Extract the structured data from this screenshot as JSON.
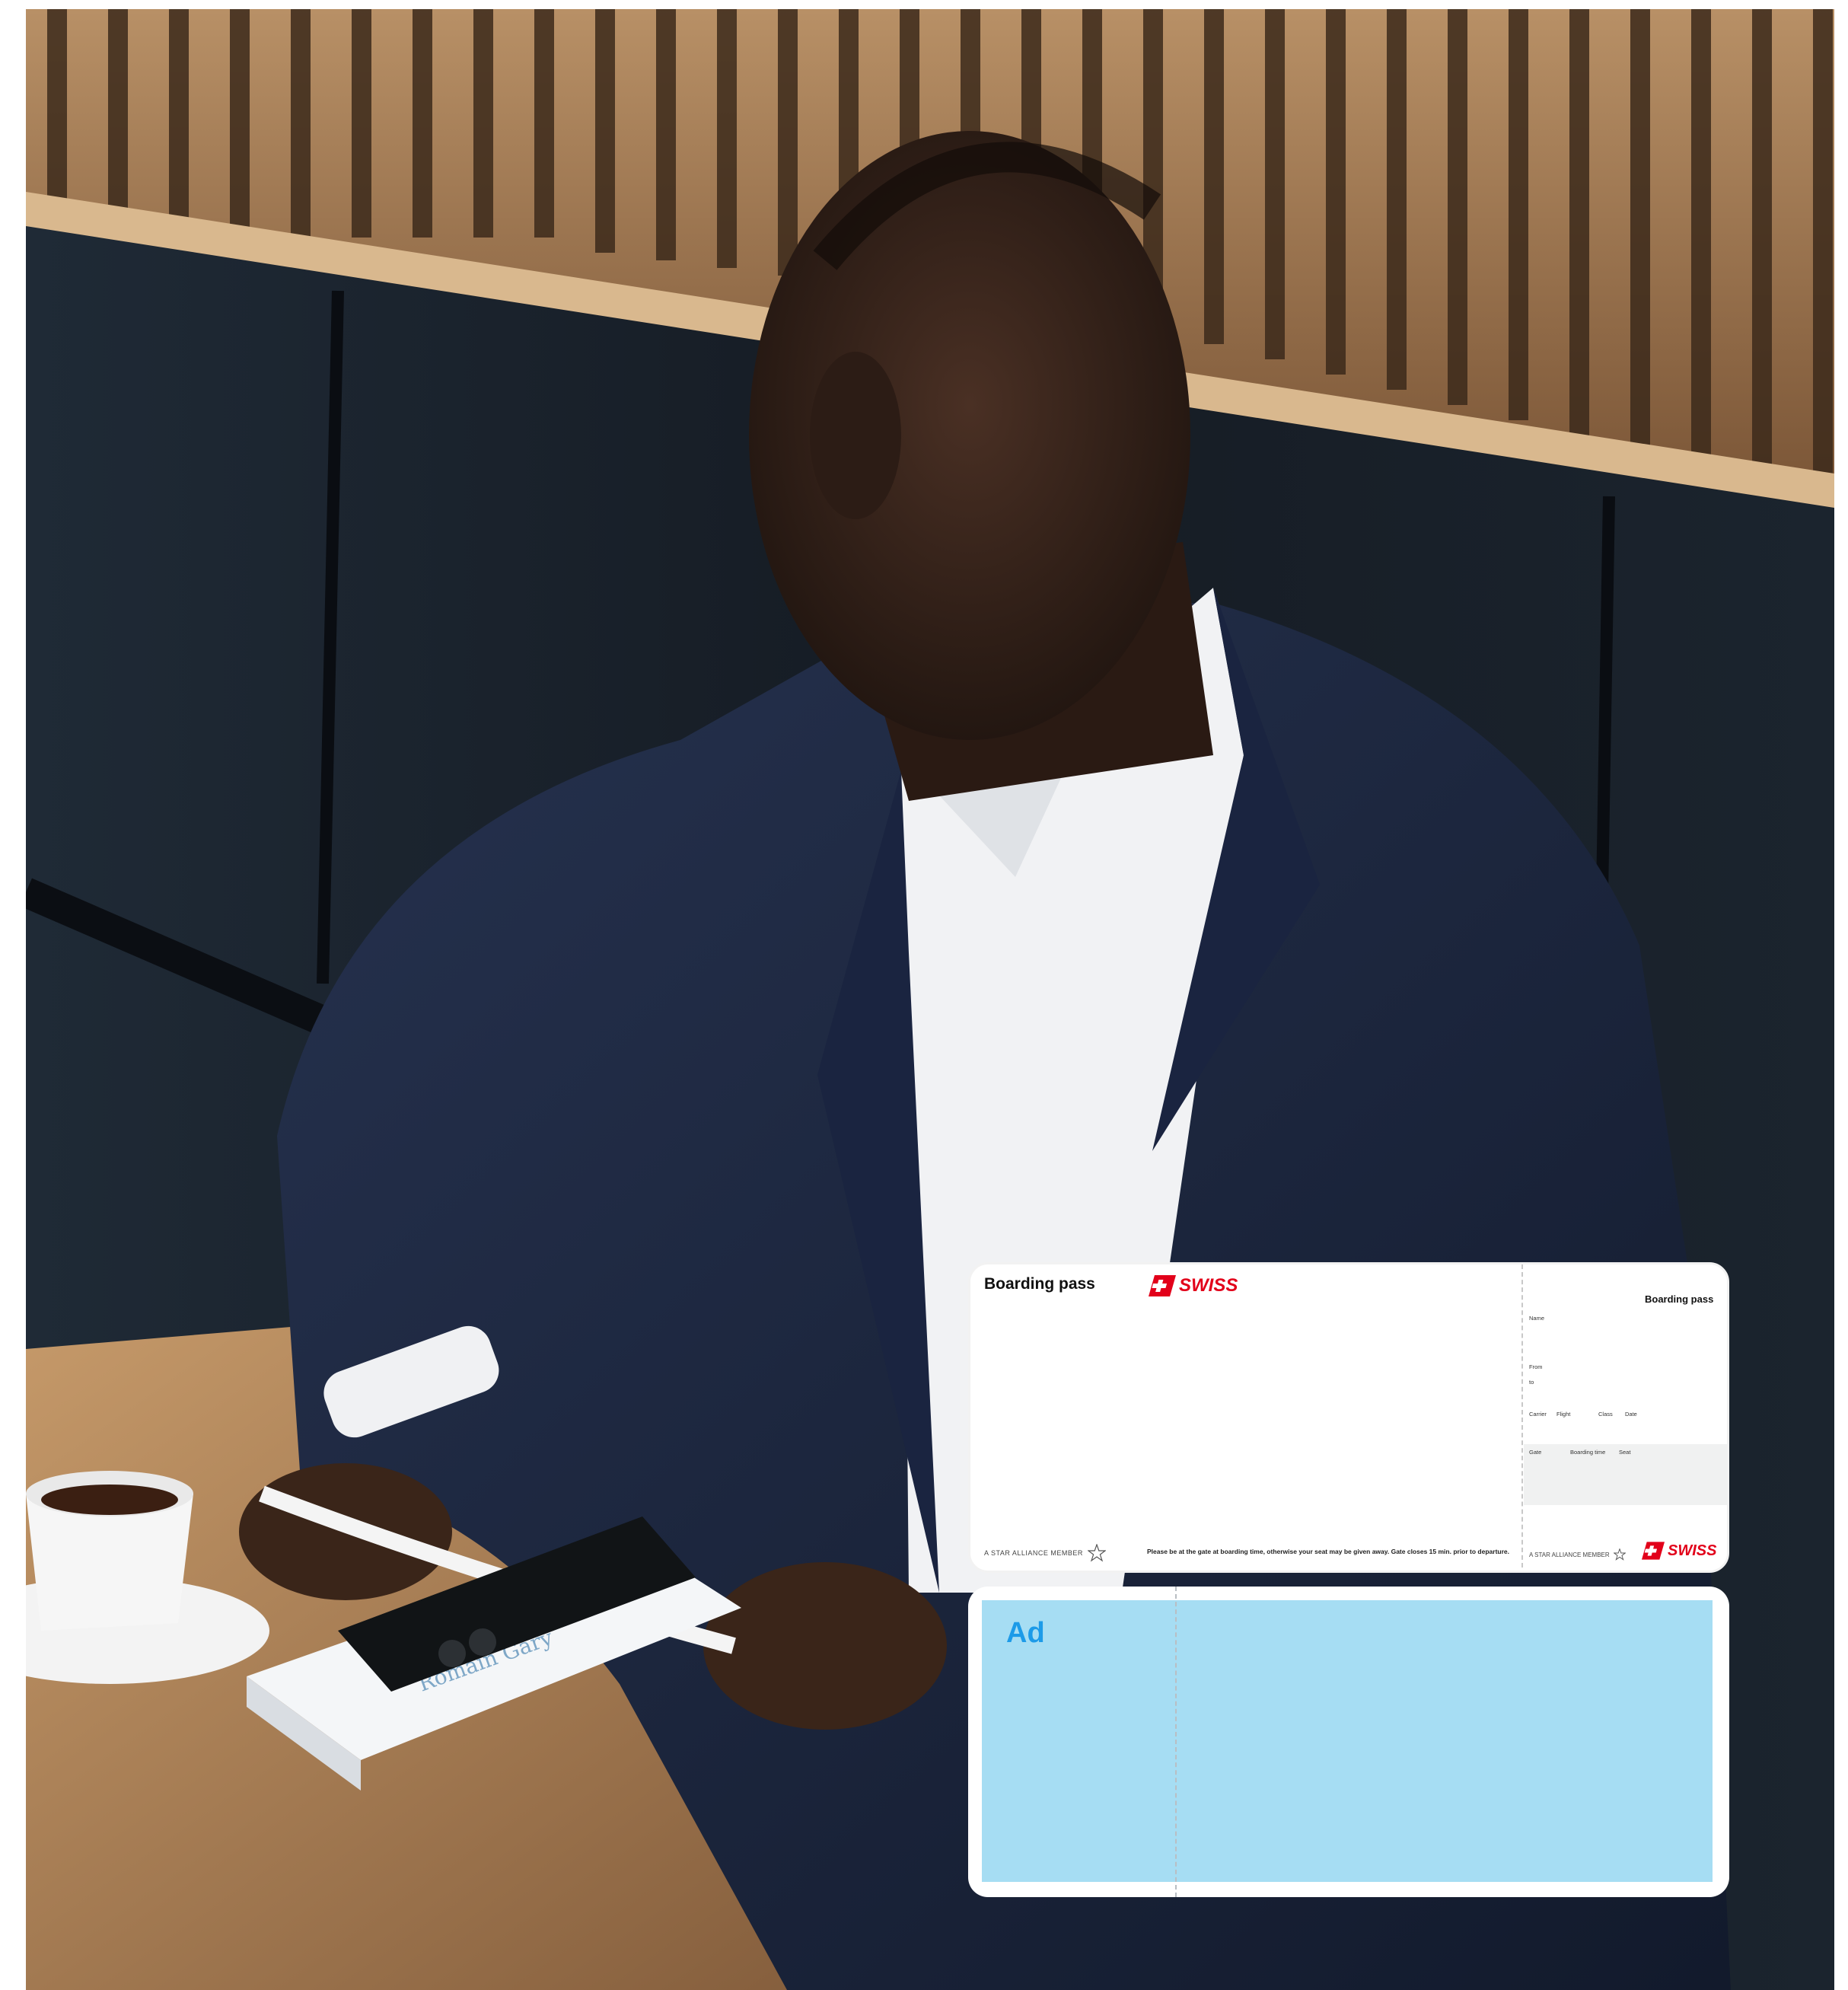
{
  "boarding_pass": {
    "title": "Boarding pass",
    "brand": "SWISS",
    "alliance": "A STAR ALLIANCE MEMBER",
    "notice": "Please be at the gate at boarding time, otherwise your seat may be given away. Gate closes 15 min. prior to departure.",
    "stub": {
      "title": "Boarding pass",
      "labels": {
        "name": "Name",
        "from": "From",
        "to": "to",
        "carrier": "Carrier",
        "flight": "Flight",
        "class": "Class",
        "date": "Date",
        "gate": "Gate",
        "boarding_time": "Boarding time",
        "seat": "Seat"
      }
    },
    "brand_color": "#e2001a"
  },
  "ad": {
    "label": "Ad",
    "color": "#a6ddf3",
    "label_color": "#1d9be8"
  },
  "photo": {
    "book_title": "Romain Gary"
  }
}
